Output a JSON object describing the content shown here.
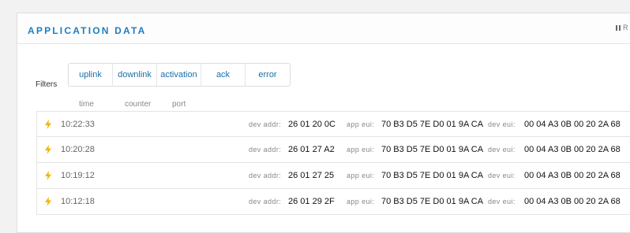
{
  "panel": {
    "title": "APPLICATION DATA",
    "pause_label": "R"
  },
  "filters": {
    "label": "Filters",
    "buttons": [
      "uplink",
      "downlink",
      "activation",
      "ack",
      "error"
    ]
  },
  "columns": [
    "time",
    "counter",
    "port"
  ],
  "row_labels": {
    "dev_addr": "dev addr:",
    "app_eui": "app eui:",
    "dev_eui": "dev eui:"
  },
  "rows": [
    {
      "time": "10:22:33",
      "dev_addr": "26 01 20 0C",
      "app_eui": "70 B3 D5 7E D0 01 9A CA",
      "dev_eui": "00 04 A3 0B 00 20 2A 68"
    },
    {
      "time": "10:20:28",
      "dev_addr": "26 01 27 A2",
      "app_eui": "70 B3 D5 7E D0 01 9A CA",
      "dev_eui": "00 04 A3 0B 00 20 2A 68"
    },
    {
      "time": "10:19:12",
      "dev_addr": "26 01 27 25",
      "app_eui": "70 B3 D5 7E D0 01 9A CA",
      "dev_eui": "00 04 A3 0B 00 20 2A 68"
    },
    {
      "time": "10:12:18",
      "dev_addr": "26 01 29 2F",
      "app_eui": "70 B3 D5 7E D0 01 9A CA",
      "dev_eui": "00 04 A3 0B 00 20 2A 68"
    }
  ],
  "colors": {
    "accent": "#1a7fc1",
    "bolt": "#f5b400"
  },
  "icons": {
    "row_type": "lightning-bolt-icon",
    "pause": "pause-icon"
  }
}
